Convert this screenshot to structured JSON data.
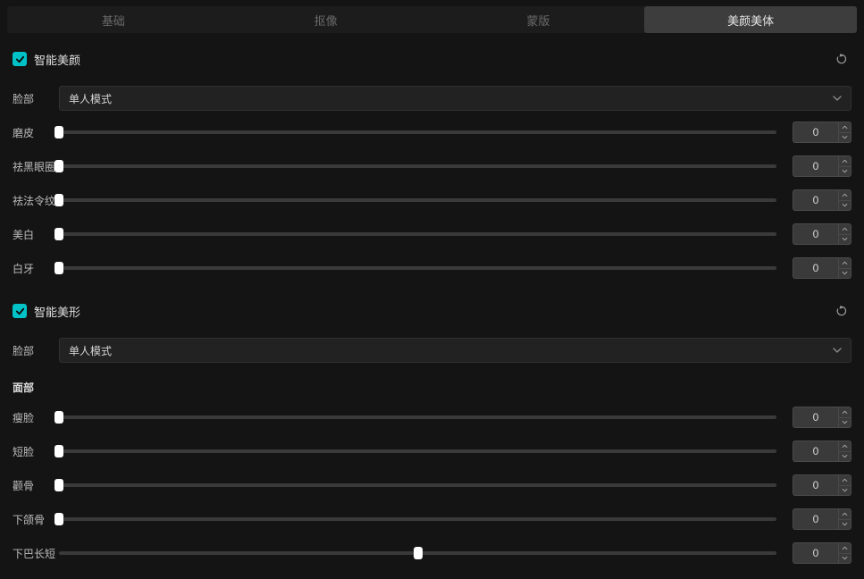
{
  "tabs": [
    {
      "label": "基础",
      "active": false
    },
    {
      "label": "抠像",
      "active": false
    },
    {
      "label": "蒙版",
      "active": false
    },
    {
      "label": "美颜美体",
      "active": true
    }
  ],
  "sections": [
    {
      "id": "beauty",
      "checked": true,
      "title": "智能美颜",
      "face_label": "脸部",
      "face_select": "单人模式",
      "sliders": [
        {
          "label": "磨皮",
          "value": 0,
          "pos": 0
        },
        {
          "label": "祛黑眼圈",
          "value": 0,
          "pos": 0
        },
        {
          "label": "祛法令纹",
          "value": 0,
          "pos": 0
        },
        {
          "label": "美白",
          "value": 0,
          "pos": 0
        },
        {
          "label": "白牙",
          "value": 0,
          "pos": 0
        }
      ]
    },
    {
      "id": "shape",
      "checked": true,
      "title": "智能美形",
      "face_label": "脸部",
      "face_select": "单人模式",
      "sub_header": "面部",
      "sliders": [
        {
          "label": "瘦脸",
          "value": 0,
          "pos": 0
        },
        {
          "label": "短脸",
          "value": 0,
          "pos": 0
        },
        {
          "label": "颧骨",
          "value": 0,
          "pos": 0
        },
        {
          "label": "下颌骨",
          "value": 0,
          "pos": 0
        },
        {
          "label": "下巴长短",
          "value": 0,
          "pos": 50
        }
      ]
    }
  ]
}
